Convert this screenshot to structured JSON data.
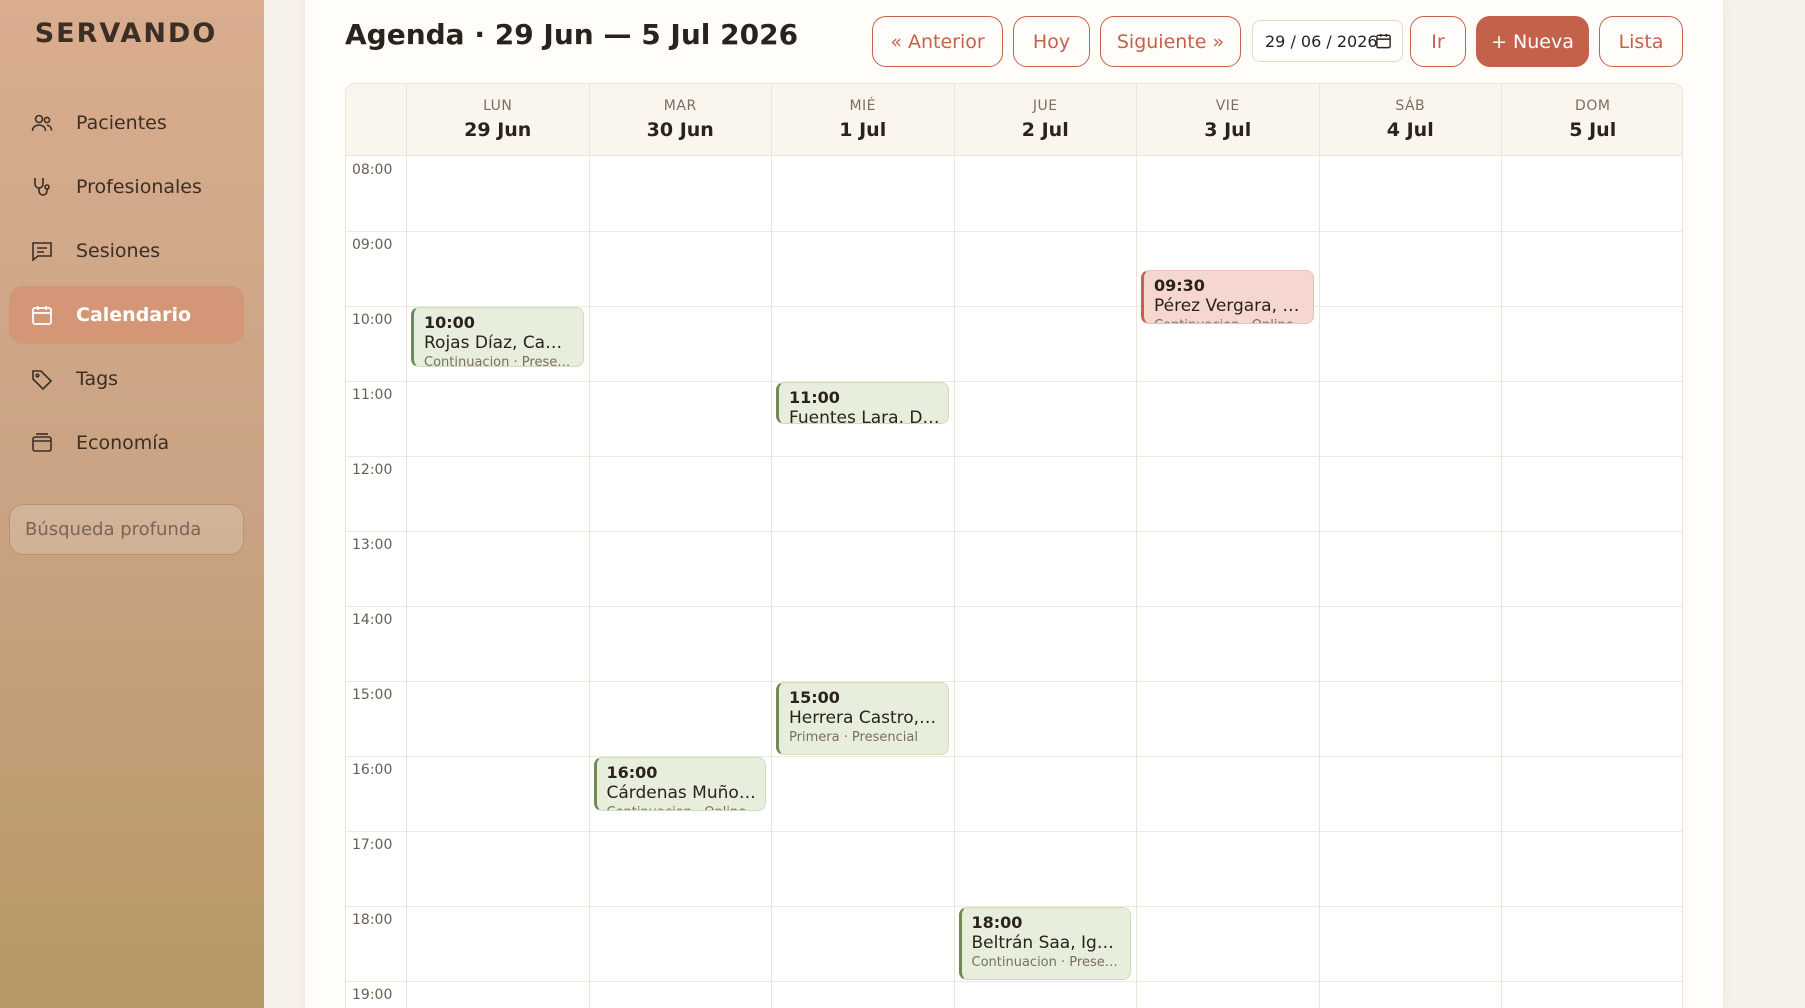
{
  "sidebar": {
    "brand": "SERVANDO",
    "items": [
      {
        "label": "Pacientes",
        "icon": "users-icon"
      },
      {
        "label": "Profesionales",
        "icon": "stethoscope-icon"
      },
      {
        "label": "Sesiones",
        "icon": "message-icon"
      },
      {
        "label": "Calendario",
        "icon": "calendar-icon",
        "active": true
      },
      {
        "label": "Tags",
        "icon": "tag-icon"
      },
      {
        "label": "Economía",
        "icon": "wallet-icon"
      }
    ],
    "search_placeholder": "Búsqueda profunda"
  },
  "header": {
    "title": "Agenda · 29 Jun — 5 Jul 2026",
    "prev_label": "« Anterior",
    "today_label": "Hoy",
    "next_label": "Siguiente »",
    "date_value": "29 / 06 / 2026",
    "go_label": "Ir",
    "new_label": "+ Nueva",
    "list_label": "Lista"
  },
  "calendar": {
    "days": [
      {
        "dow": "LUN",
        "date": "29 Jun"
      },
      {
        "dow": "MAR",
        "date": "30 Jun"
      },
      {
        "dow": "MIÉ",
        "date": "1 Jul"
      },
      {
        "dow": "JUE",
        "date": "2 Jul"
      },
      {
        "dow": "VIE",
        "date": "3 Jul"
      },
      {
        "dow": "SÁB",
        "date": "4 Jul"
      },
      {
        "dow": "DOM",
        "date": "5 Jul"
      }
    ],
    "hours": [
      "08:00",
      "09:00",
      "10:00",
      "11:00",
      "12:00",
      "13:00",
      "14:00",
      "15:00",
      "16:00",
      "17:00",
      "18:00",
      "19:00"
    ],
    "events": [
      {
        "day": 0,
        "start": "10:00",
        "duration_hours": 0.83,
        "time": "10:00",
        "name": "Rojas Díaz, Camila",
        "meta": "Continuacion · Presencial",
        "tone": "green"
      },
      {
        "day": 4,
        "start": "09:30",
        "duration_hours": 0.75,
        "time": "09:30",
        "name": "Pérez Vergara, Constanza",
        "meta": "Continuacion · Online",
        "tone": "red"
      },
      {
        "day": 2,
        "start": "11:00",
        "duration_hours": 0.58,
        "time": "11:00",
        "name": "Fuentes Lara, Daniela",
        "meta": "",
        "tone": "green"
      },
      {
        "day": 2,
        "start": "15:00",
        "duration_hours": 1.0,
        "time": "15:00",
        "name": "Herrera Castro, Tomás",
        "meta": "Primera · Presencial",
        "tone": "green"
      },
      {
        "day": 1,
        "start": "16:00",
        "duration_hours": 0.75,
        "time": "16:00",
        "name": "Cárdenas Muñoz, Valentina",
        "meta": "Continuacion · Online",
        "tone": "green"
      },
      {
        "day": 3,
        "start": "18:00",
        "duration_hours": 1.0,
        "time": "18:00",
        "name": "Beltrán Saa, Ignacio",
        "meta": "Continuacion · Presencial",
        "tone": "green"
      }
    ]
  },
  "colors": {
    "accent": "#c4614b",
    "sidebar_active": "#d68c6e",
    "event_green": "#e7eedc",
    "event_red": "#f5d7cf"
  }
}
